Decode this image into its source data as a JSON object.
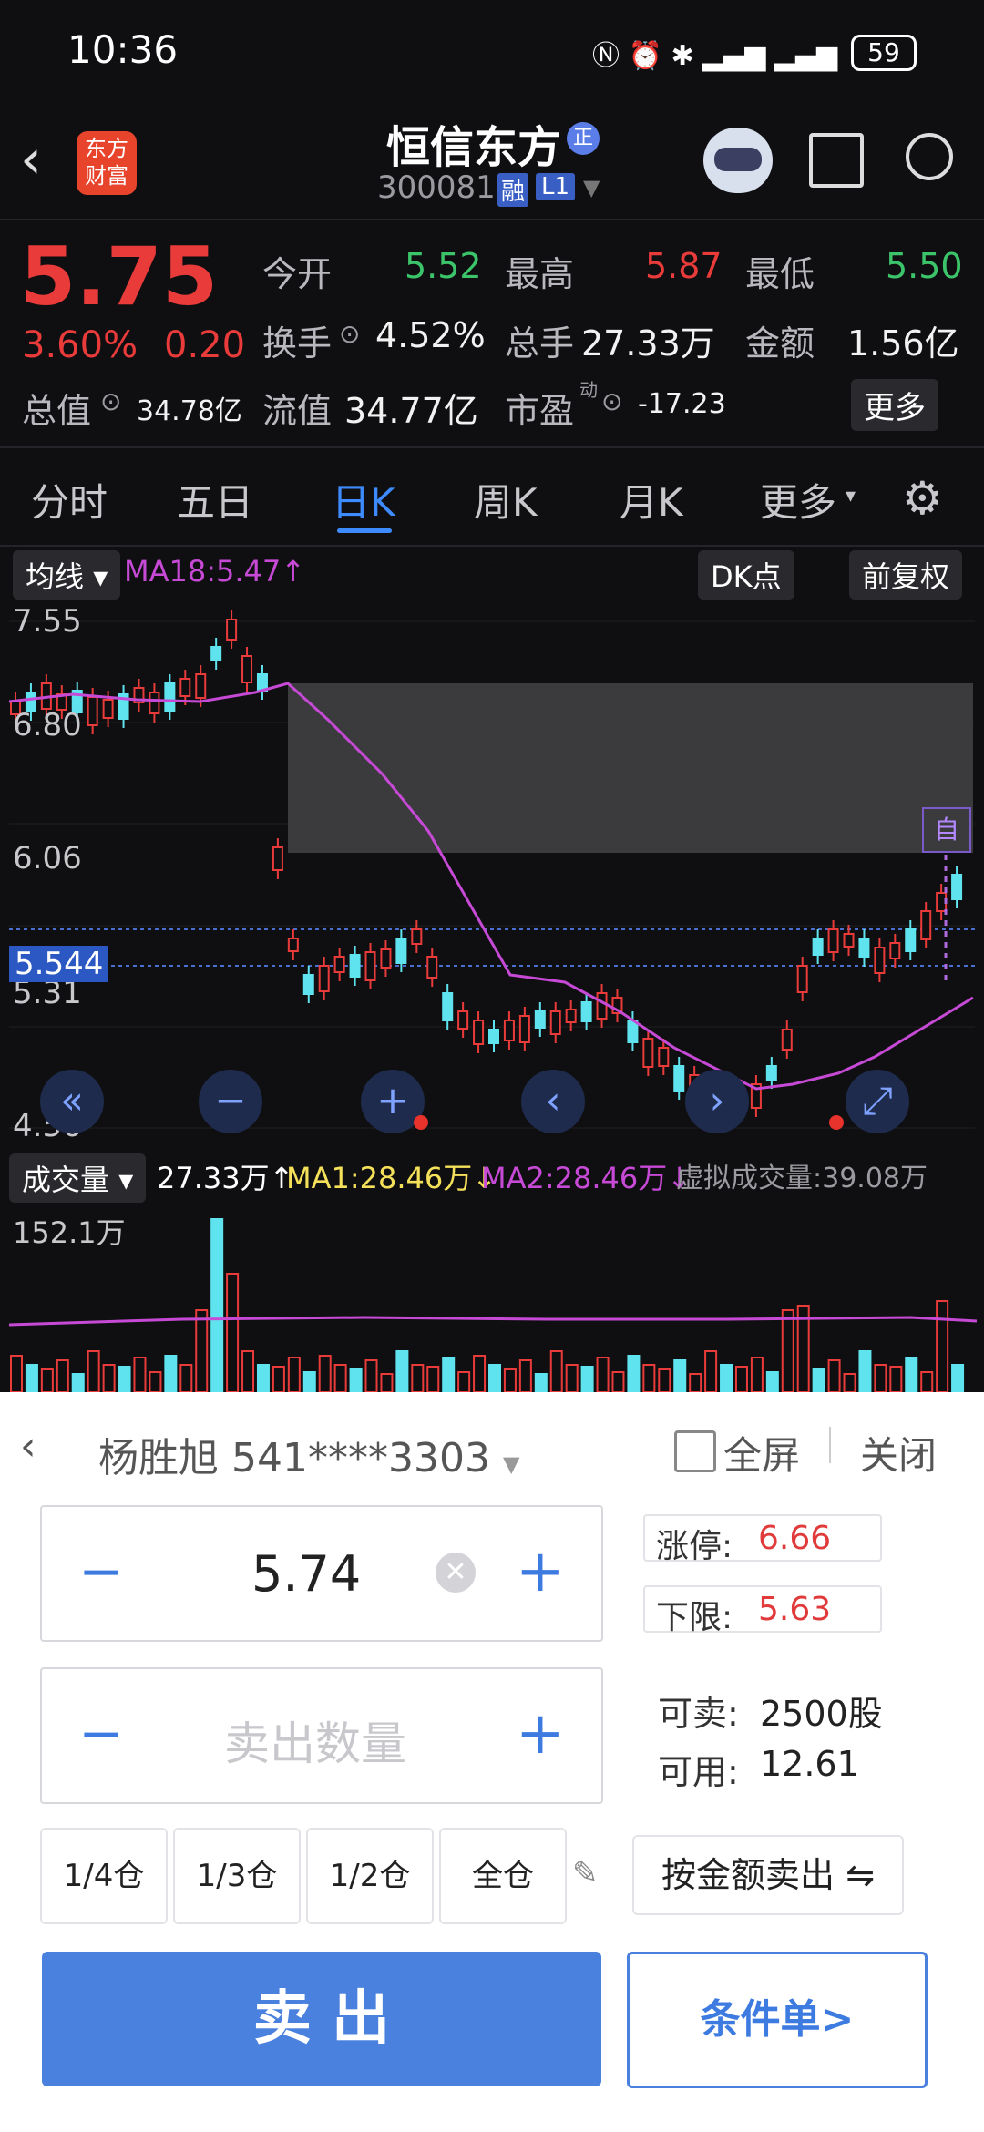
{
  "status_bar": {
    "time": "10:36",
    "battery": "59"
  },
  "header": {
    "logo_line1": "东方",
    "logo_line2": "财富",
    "stock_name": "恒信东方",
    "stock_tag": "正",
    "stock_code": "300081",
    "margin_tag": "融",
    "level_tag": "L1"
  },
  "quote": {
    "price": "5.75",
    "change_pct": "3.60%",
    "change_amt": "0.20",
    "open_label": "今开",
    "open": "5.52",
    "high_label": "最高",
    "high": "5.87",
    "low_label": "最低",
    "low": "5.50",
    "turnover_label": "换手",
    "turnover": "4.52%",
    "volume_label": "总手",
    "volume": "27.33万",
    "amount_label": "金额",
    "amount": "1.56亿",
    "mktcap_label": "总值",
    "mktcap": "34.78亿",
    "float_label": "流值",
    "float": "34.77亿",
    "pe_label": "市盈",
    "pe_sup": "动",
    "pe": "-17.23",
    "more": "更多"
  },
  "tabs": [
    "分时",
    "五日",
    "日K",
    "周K",
    "月K",
    "更多"
  ],
  "active_tab": "日K",
  "kline": {
    "ma_selector": "均线",
    "ma18": "MA18:5.47",
    "dk_label": "DK点",
    "adjust_label": "前复权",
    "price_labels": [
      "7.55",
      "6.80",
      "6.06",
      "5.31",
      "4.56"
    ],
    "current_marker": "5.544",
    "box_tag": "自"
  },
  "chart_data": [
    {
      "type": "candlestick",
      "title": "",
      "ylim": [
        4.56,
        7.55
      ],
      "ma18_last": 5.47,
      "marker_price": 5.544
    },
    {
      "type": "bar",
      "title": "成交量",
      "volume": "27.33万",
      "ma1": "MA1:28.46万",
      "ma2": "MA2:28.46万",
      "virtual": "虚拟成交量:39.08万",
      "ymax_label": "152.1万"
    }
  ],
  "trade": {
    "account_name": "杨胜旭",
    "account_no": "541****3303",
    "fullscreen": "全屏",
    "close": "关闭",
    "price_value": "5.74",
    "qty_placeholder": "卖出数量",
    "limit_up_label": "涨停:",
    "limit_up": "6.66",
    "lower_label": "下限:",
    "lower": "5.63",
    "sellable_label": "可卖:",
    "sellable": "2500股",
    "available_label": "可用:",
    "available": "12.61",
    "positions": [
      "1/4仓",
      "1/3仓",
      "1/2仓",
      "全仓"
    ],
    "by_amount": "按金额卖出",
    "sell_button": "卖 出",
    "condition_button": "条件单>"
  },
  "colors": {
    "red": "#ea3b3b",
    "green": "#3cc46b",
    "blue": "#3d7be0",
    "ma_purple": "#c74ad6",
    "volume_cyan": "#5fe3ee"
  }
}
